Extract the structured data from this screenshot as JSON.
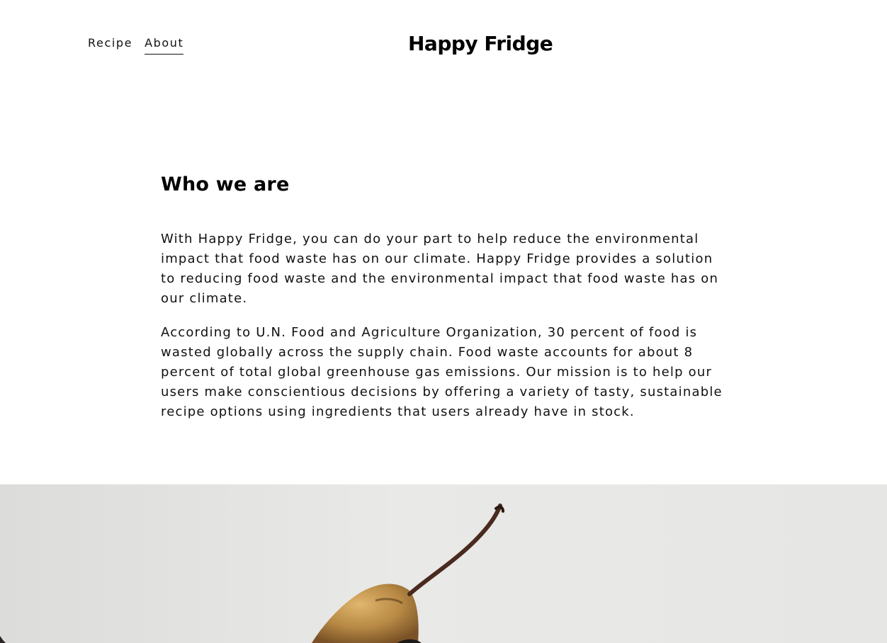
{
  "nav": {
    "items": [
      {
        "label": "Recipe"
      },
      {
        "label": "About"
      }
    ],
    "active_index": 1
  },
  "brand": {
    "title": "Happy Fridge"
  },
  "about": {
    "heading": "Who we are",
    "paragraphs": [
      "With Happy Fridge, you can do your part to help reduce the environmental impact that food waste has on our climate. Happy Fridge provides a solution to reducing food waste and the environmental impact that food waste has on our climate.",
      "According to U.N. Food and Agriculture Organization, 30 percent of food is wasted globally across the supply chain. Food waste accounts for about 8 percent of total global greenhouse gas emissions. Our mission is to help our users make conscientious decisions by offering a variety of tasty, sustainable recipe options using ingredients that users already have in stock."
    ]
  },
  "hero": {
    "image": "overripe-pear-photo",
    "colors": {
      "background": "#e6e6e4",
      "pear": "#b88a45",
      "stem": "#4a2a1e"
    }
  }
}
